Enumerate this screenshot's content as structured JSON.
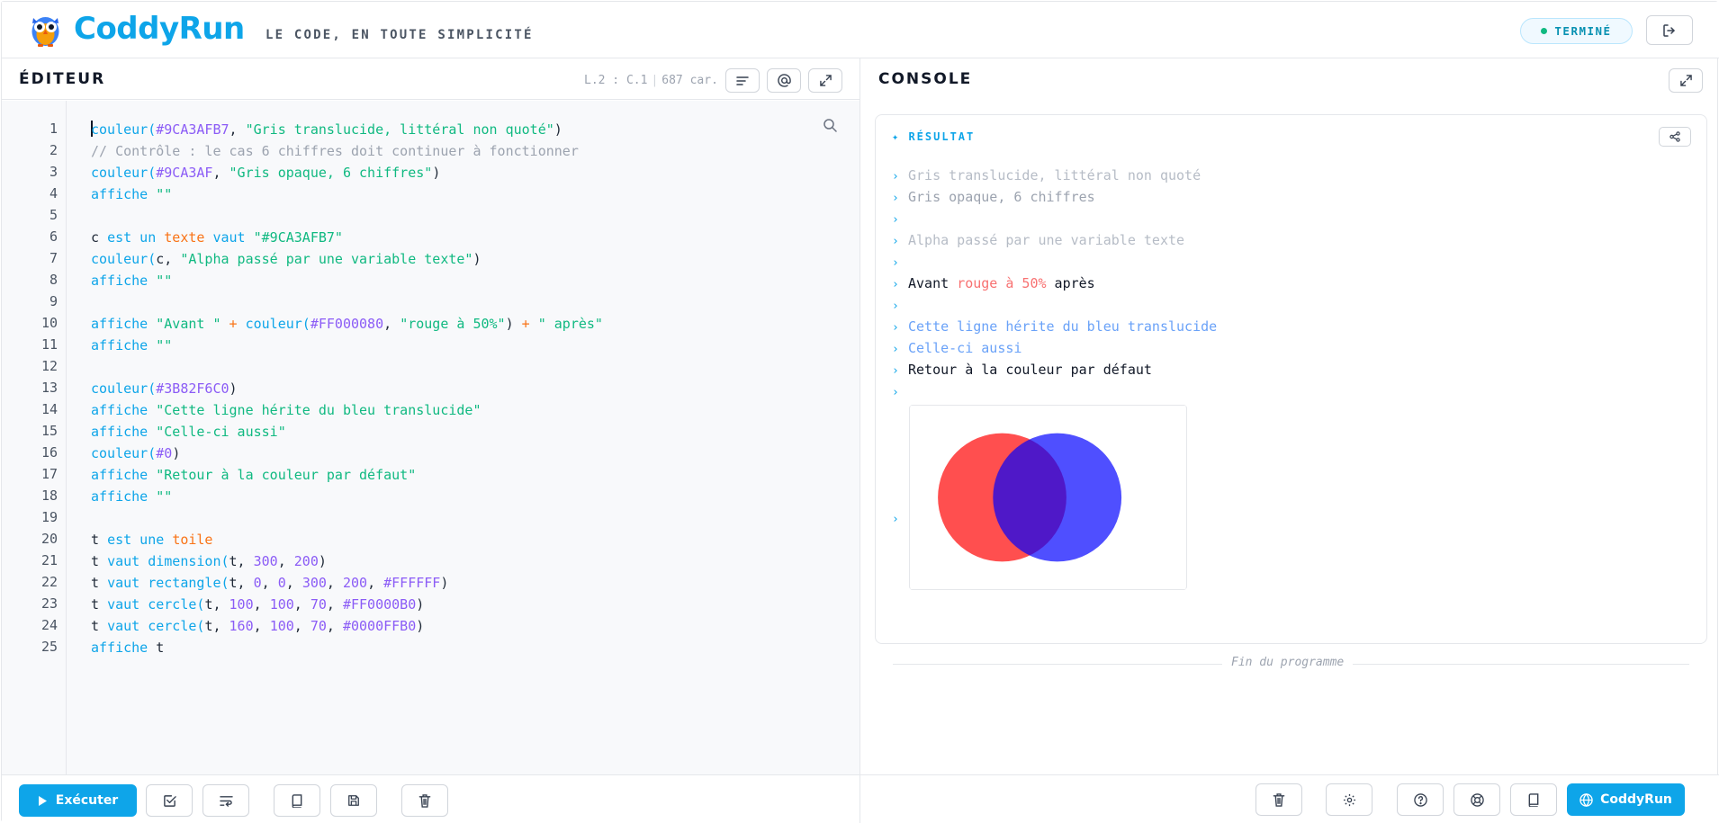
{
  "header": {
    "brand": "CoddyRun",
    "tagline": "LE CODE, EN TOUTE SIMPLICITÉ",
    "status": "TERMINÉ"
  },
  "editor": {
    "title": "ÉDITEUR",
    "cursor": "L.2 : C.1",
    "chars": "687 car.",
    "line_numbers": [
      "1",
      "2",
      "3",
      "4",
      "5",
      "6",
      "7",
      "8",
      "9",
      "10",
      "11",
      "12",
      "13",
      "14",
      "15",
      "16",
      "17",
      "18",
      "19",
      "20",
      "21",
      "22",
      "23",
      "24",
      "25"
    ],
    "code": {
      "l1a": "couleur(",
      "l1b": "#9CA3AFB7",
      "l1c": ", ",
      "l1d": "\"Gris translucide, littéral non quoté\"",
      "l1e": ")",
      "l2": "// Contrôle : le cas 6 chiffres doit continuer à fonctionner",
      "l3a": "couleur(",
      "l3b": "#9CA3AF",
      "l3c": ", ",
      "l3d": "\"Gris opaque, 6 chiffres\"",
      "l3e": ")",
      "l4a": "affiche ",
      "l4b": "\"\"",
      "l6a": "c ",
      "l6b": "est un ",
      "l6c": "texte",
      "l6d": " vaut ",
      "l6e": "\"#9CA3AFB7\"",
      "l7a": "couleur(",
      "l7b": "c, ",
      "l7c": "\"Alpha passé par une variable texte\"",
      "l7d": ")",
      "l8a": "affiche ",
      "l8b": "\"\"",
      "l10a": "affiche ",
      "l10b": "\"Avant \"",
      "l10c": " + ",
      "l10d": "couleur(",
      "l10e": "#FF000080",
      "l10f": ", ",
      "l10g": "\"rouge à 50%\"",
      "l10h": ")",
      "l10i": " + ",
      "l10j": "\" après\"",
      "l11a": "affiche ",
      "l11b": "\"\"",
      "l13a": "couleur(",
      "l13b": "#3B82F6C0",
      "l13c": ")",
      "l14a": "affiche ",
      "l14b": "\"Cette ligne hérite du bleu translucide\"",
      "l15a": "affiche ",
      "l15b": "\"Celle-ci aussi\"",
      "l16a": "couleur(",
      "l16b": "#0",
      "l16c": ")",
      "l17a": "affiche ",
      "l17b": "\"Retour à la couleur par défaut\"",
      "l18a": "affiche ",
      "l18b": "\"\"",
      "l20a": "t ",
      "l20b": "est une ",
      "l20c": "toile",
      "l21a": "t ",
      "l21b": "vaut ",
      "l21c": "dimension(",
      "l21d": "t, ",
      "l21e": "300",
      "l21f": ", ",
      "l21g": "200",
      "l21h": ")",
      "l22a": "t ",
      "l22b": "vaut ",
      "l22c": "rectangle(",
      "l22d": "t, ",
      "l22e": "0",
      "l22f": ", ",
      "l22g": "0",
      "l22h": ", ",
      "l22i": "300",
      "l22j": ", ",
      "l22k": "200",
      "l22l": ", ",
      "l22m": "#FFFFFF",
      "l22n": ")",
      "l23a": "t ",
      "l23b": "vaut ",
      "l23c": "cercle(",
      "l23d": "t, ",
      "l23e": "100",
      "l23f": ", ",
      "l23g": "100",
      "l23h": ", ",
      "l23i": "70",
      "l23j": ", ",
      "l23k": "#FF0000B0",
      "l23l": ")",
      "l24a": "t ",
      "l24b": "vaut ",
      "l24c": "cercle(",
      "l24d": "t, ",
      "l24e": "160",
      "l24f": ", ",
      "l24g": "100",
      "l24h": ", ",
      "l24i": "70",
      "l24j": ", ",
      "l24k": "#0000FFB0",
      "l24l": ")",
      "l25a": "affiche ",
      "l25b": "t"
    },
    "run_label": "Exécuter"
  },
  "console": {
    "title": "CONSOLE",
    "result_label": "✦ RÉSULTAT",
    "chevron": "›",
    "output": {
      "o1": "Gris translucide, littéral non quoté",
      "o2": "Gris opaque, 6 chiffres",
      "o4": "Alpha passé par une variable texte",
      "o6a": "Avant ",
      "o6b": "rouge à 50%",
      "o6c": " après",
      "o8": "Cette ligne hérite du bleu translucide",
      "o9": "Celle-ci aussi",
      "o10": "Retour à la couleur par défaut"
    },
    "end_text": "Fin du programme",
    "brand_button": "CoddyRun"
  },
  "colors": {
    "accent": "#0ea5e9",
    "grey_translucent": "#9CA3AFB7",
    "grey_opaque": "#9CA3AF",
    "red_half": "#FF000080",
    "blue_translucent": "#3B82F6C0",
    "circle_red": "#FF0000B0",
    "circle_blue": "#0000FFB0"
  },
  "icons": [
    "owl-logo-icon",
    "logout-icon",
    "format-icon",
    "at-sign-icon",
    "expand-icon",
    "search-icon",
    "play-icon",
    "check-square-icon",
    "wrap-icon",
    "book-icon",
    "save-icon",
    "trash-icon",
    "share-icon",
    "gear-icon",
    "help-icon",
    "lifebuoy-icon",
    "globe-icon"
  ]
}
